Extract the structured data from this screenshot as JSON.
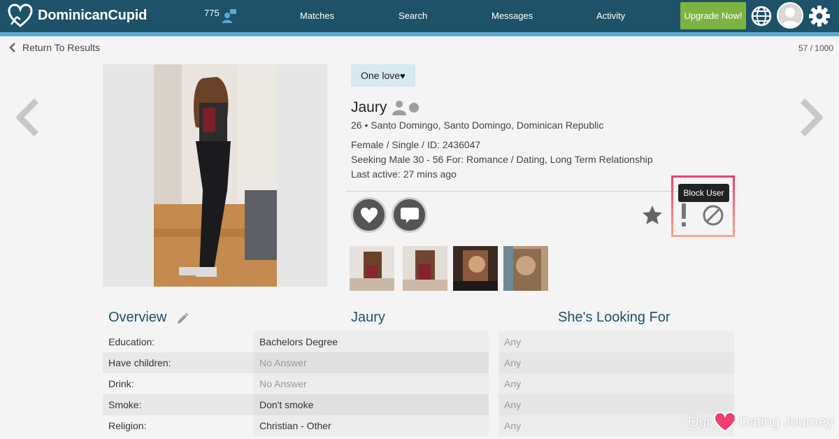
{
  "header": {
    "brand": "DominicanCupid",
    "online_count": "775",
    "nav": [
      "Matches",
      "Search",
      "Messages",
      "Activity"
    ],
    "upgrade_label": "Upgrade Now!"
  },
  "subnav": {
    "back_label": "Return To Results",
    "pager": "57 / 1000"
  },
  "profile": {
    "tagline": "One love",
    "tagline_heart": "♥",
    "name": "Jaury",
    "location": "26 • Santo Domingo, Santo Domingo, Dominican Republic",
    "details": "Female / Single / ID: 2436047",
    "seeking": "Seeking Male 30 - 56 For: Romance / Dating, Long Term Relationship",
    "last_active": "Last active: 27 mins ago"
  },
  "actions": {
    "tooltip": "Block User",
    "icons": [
      "heart-icon",
      "chat-icon",
      "star-icon",
      "report-icon",
      "block-icon"
    ]
  },
  "overview": {
    "title": "Overview",
    "col_profile": "Jaury",
    "col_seeking": "She's Looking For",
    "rows": [
      {
        "label": "Education:",
        "value": "Bachelors Degree",
        "looking": "Any"
      },
      {
        "label": "Have children:",
        "value": "No Answer",
        "looking": "Any"
      },
      {
        "label": "Drink:",
        "value": "No Answer",
        "looking": "Any"
      },
      {
        "label": "Smoke:",
        "value": "Don't smoke",
        "looking": "Any"
      },
      {
        "label": "Religion:",
        "value": "Christian - Other",
        "looking": "Any"
      }
    ]
  },
  "watermark": {
    "before": "Our",
    "after": "Dating Journey"
  },
  "colors": {
    "header": "#1e5268",
    "stripe": "#5aa9cf",
    "upgrade": "#7cb342",
    "highlight": "#ee3f6d"
  }
}
